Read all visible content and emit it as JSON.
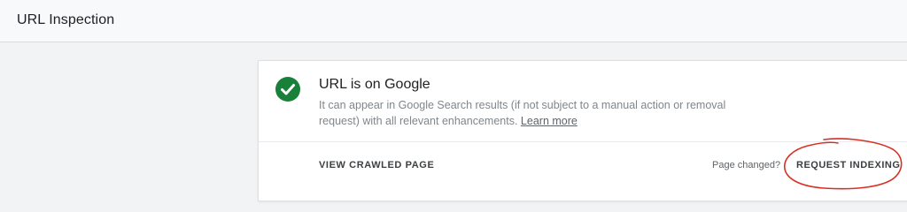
{
  "header": {
    "title": "URL Inspection"
  },
  "status_card": {
    "icon": "check-circle-icon",
    "title": "URL is on Google",
    "description": "It can appear in Google Search results (if not subject to a manual action or removal request) with all relevant enhancements.",
    "learn_more_label": "Learn more",
    "view_crawled_label": "VIEW CRAWLED PAGE",
    "page_changed_text": "Page changed?",
    "request_indexing_label": "REQUEST INDEXING"
  },
  "colors": {
    "success_green": "#188038",
    "annotation_red": "#d93025",
    "header_bg": "#f8f9fa",
    "page_bg": "#f1f3f4"
  }
}
